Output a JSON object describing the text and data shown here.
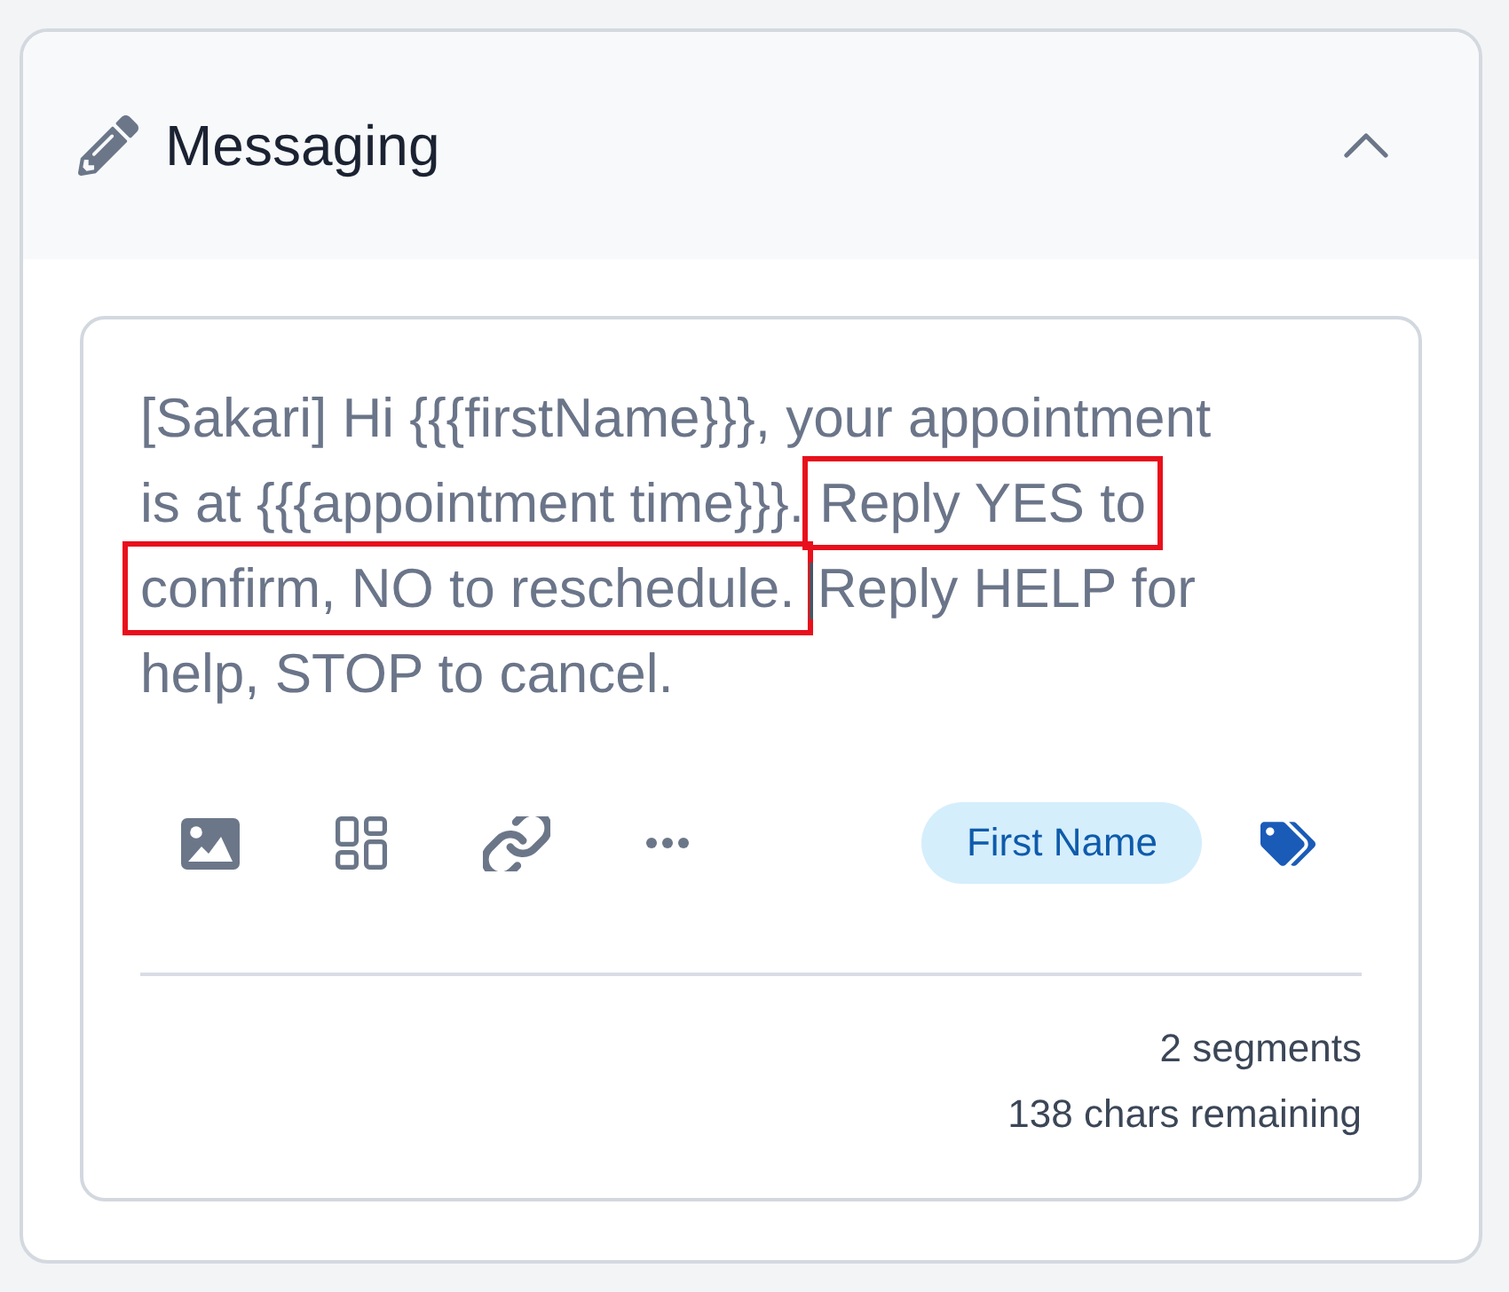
{
  "section": {
    "title": "Messaging",
    "expanded": true
  },
  "message": {
    "segments": [
      {
        "text": "[Sakari] Hi {{{firstName}}}, your appointment",
        "highlighted": false,
        "cursor_before": false
      },
      {
        "text": "is at {{{appointment time}}}.",
        "highlighted": false,
        "cursor_before": false
      },
      {
        "text": "Reply YES to",
        "highlighted": true,
        "cursor_before": false
      },
      {
        "text": "confirm, NO to reschedule.",
        "highlighted": true,
        "cursor_before": false
      },
      {
        "text": "Reply HELP for",
        "highlighted": false,
        "cursor_before": true
      },
      {
        "text": "help, STOP to cancel.",
        "highlighted": false,
        "cursor_before": false
      }
    ]
  },
  "toolbar": {
    "tag_chip": "First Name"
  },
  "footer": {
    "segments": "2 segments",
    "remaining": "138 chars remaining"
  }
}
